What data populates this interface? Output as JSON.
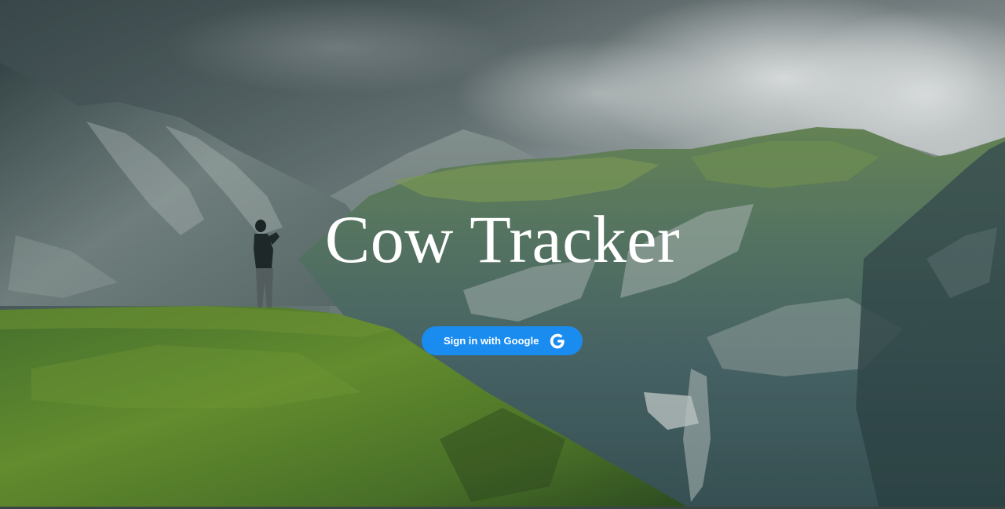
{
  "app": {
    "title": "Cow Tracker"
  },
  "auth": {
    "signin_label": "Sign in with Google",
    "signin_icon": "google-g-icon",
    "button_color": "#1a8cf0"
  },
  "background": {
    "image": "mountain-landscape-photo"
  }
}
